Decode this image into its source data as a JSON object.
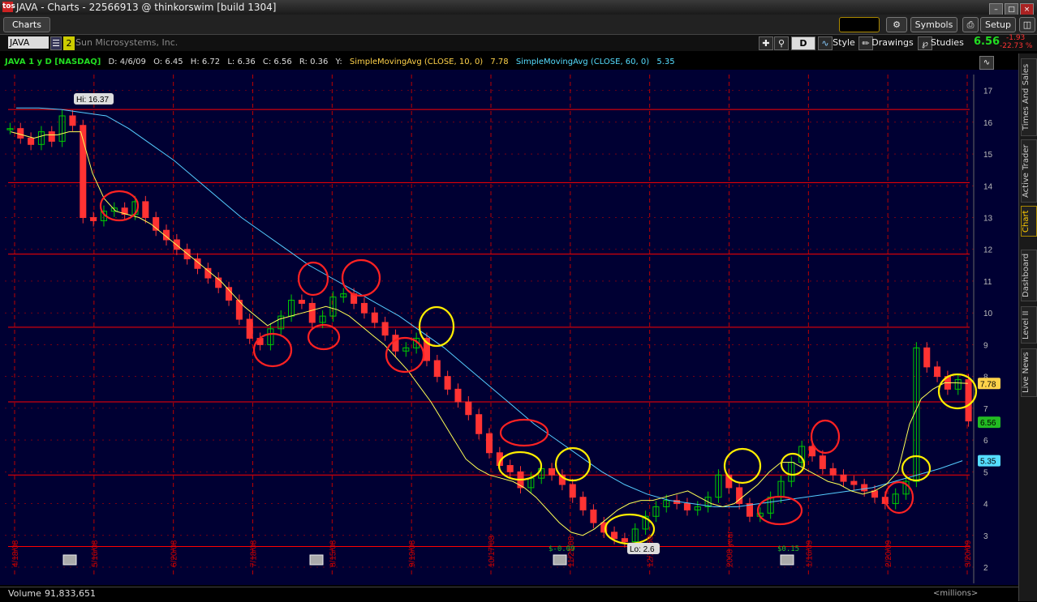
{
  "window": {
    "title": "JAVA - Charts - 22566913 @ thinkorswim [build 1304]",
    "logo": "tos"
  },
  "menu": {
    "tab": "Charts",
    "symbols": "Symbols",
    "setup": "Setup"
  },
  "toolbar": {
    "symbol": "JAVA",
    "link_num": "2",
    "company": "Sun Microsystems, Inc.",
    "agg": "D",
    "style": "Style",
    "drawings": "Drawings",
    "studies": "Studies",
    "last": "6.56",
    "change": "-1.93",
    "change_pct": "-22.73 %"
  },
  "info": {
    "desc": "JAVA 1 y D [NASDAQ]",
    "date": "D: 4/6/09",
    "open": "O: 6.45",
    "high": "H: 6.72",
    "low": "L: 6.36",
    "close": "C: 6.56",
    "range": "R: 0.36",
    "y": "Y:",
    "sma1_label": "SimpleMovingAvg (CLOSE, 10, 0)",
    "sma1_value": "7.78",
    "sma2_label": "SimpleMovingAvg (CLOSE, 60, 0)",
    "sma2_value": "5.35"
  },
  "side_tabs": [
    "Times And Sales",
    "Active Trader",
    "Chart",
    "Dashboard",
    "Level II",
    "Live News"
  ],
  "volume": {
    "label": "Volume",
    "value": "91,833,651",
    "units": "<millions>"
  },
  "colors": {
    "background": "#000033",
    "price_line": "#ff0000",
    "grid": "#bb0000",
    "sma10": "#ffff55",
    "sma60": "#55ccff",
    "up": "#00cc00",
    "down": "#ff3333",
    "circle_red": "#ff2222",
    "circle_yellow": "#ffee00"
  },
  "chart_data": {
    "type": "candlestick",
    "ylim": [
      2,
      17.5
    ],
    "y_ticks": [
      2,
      3,
      4,
      5,
      6,
      7,
      8,
      9,
      10,
      11,
      12,
      13,
      14,
      15,
      16,
      17
    ],
    "x_labels": [
      "4/18/08",
      "5/16/08",
      "6/20/08",
      "7/18/08",
      "8/15/08",
      "9/19/08",
      "10/17/08",
      "11/21/08",
      "12/19/08",
      "2008 year",
      "1/16/09",
      "2/20/09",
      "3/20/09"
    ],
    "high_label": "Hi: 16.37",
    "low_label": "Lo: 2.6",
    "events": [
      "$-0.09",
      "$0.15"
    ],
    "price_axis_tags": [
      {
        "text": "7.78",
        "color": "#ffd24a"
      },
      {
        "text": "6.56",
        "color": "#22bb22"
      },
      {
        "text": "5.35",
        "color": "#55ddff"
      }
    ],
    "close_series": [
      15.8,
      15.5,
      15.3,
      15.7,
      15.4,
      16.2,
      15.9,
      13.0,
      12.9,
      13.2,
      13.3,
      13.1,
      13.5,
      13.0,
      12.6,
      12.3,
      12.0,
      11.7,
      11.4,
      11.1,
      10.8,
      10.4,
      9.8,
      9.2,
      9.0,
      9.5,
      9.9,
      10.4,
      10.3,
      9.7,
      9.9,
      10.5,
      10.6,
      10.3,
      10.0,
      9.7,
      9.3,
      8.8,
      8.9,
      9.2,
      8.5,
      8.0,
      7.6,
      7.2,
      6.8,
      6.2,
      5.6,
      5.2,
      5.0,
      4.5,
      4.8,
      5.1,
      4.9,
      4.6,
      4.2,
      3.8,
      3.4,
      3.1,
      2.9,
      2.8,
      3.2,
      3.6,
      3.9,
      4.1,
      4.0,
      3.8,
      3.9,
      4.2,
      4.9,
      4.5,
      4.0,
      3.6,
      3.7,
      4.2,
      4.7,
      5.3,
      5.8,
      5.5,
      5.1,
      4.9,
      4.7,
      4.6,
      4.4,
      4.2,
      4.0,
      4.3,
      4.7,
      8.9,
      8.3,
      8.0,
      7.6,
      7.9,
      6.6
    ],
    "sma10": [
      15.7,
      15.6,
      15.5,
      15.6,
      15.6,
      15.7,
      15.7,
      14.4,
      13.6,
      13.2,
      13.1,
      13.0,
      12.8,
      12.5,
      12.2,
      11.9,
      11.6,
      11.3,
      11.0,
      10.6,
      10.2,
      9.9,
      9.6,
      9.8,
      9.9,
      10.0,
      10.1,
      10.2,
      10.1,
      9.9,
      9.6,
      9.3,
      9.0,
      8.6,
      8.2,
      7.7,
      7.2,
      6.6,
      6.0,
      5.4,
      5.1,
      4.9,
      4.8,
      4.7,
      4.5,
      4.2,
      3.8,
      3.4,
      3.1,
      3.0,
      3.2,
      3.5,
      3.8,
      4.0,
      4.1,
      4.1,
      4.2,
      4.3,
      4.4,
      4.2,
      4.0,
      3.9,
      4.0,
      4.3,
      4.6,
      5.0,
      5.3,
      5.3,
      5.1,
      4.9,
      4.7,
      4.6,
      4.4,
      4.3,
      4.4,
      4.6,
      5.0,
      6.5,
      7.3,
      7.6,
      7.8,
      7.8,
      7.78
    ],
    "sma60": [
      16.45,
      16.45,
      16.4,
      16.3,
      16.2,
      15.8,
      15.3,
      14.8,
      14.2,
      13.6,
      13.0,
      12.5,
      12.0,
      11.5,
      11.1,
      10.7,
      10.3,
      9.9,
      9.4,
      8.9,
      8.3,
      7.7,
      7.1,
      6.5,
      6.0,
      5.5,
      5.0,
      4.6,
      4.3,
      4.1,
      4.0,
      3.9,
      3.9,
      4.0,
      4.1,
      4.2,
      4.3,
      4.4,
      4.5,
      4.7,
      4.9,
      5.1,
      5.35
    ]
  }
}
